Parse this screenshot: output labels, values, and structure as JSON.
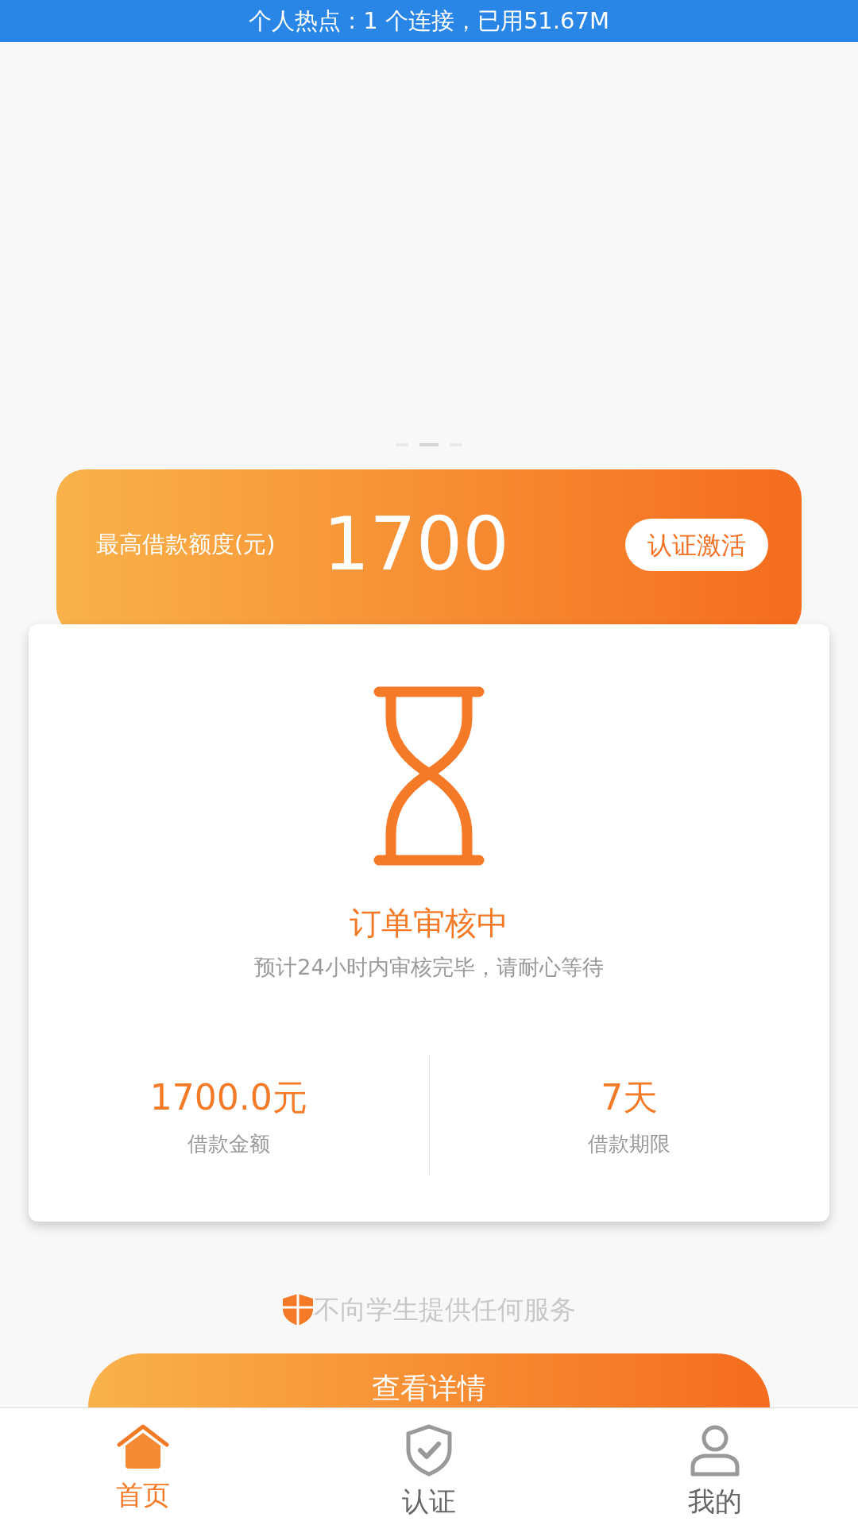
{
  "status_bar": {
    "text": "个人热点 : 1 个连接，已用51.67M"
  },
  "carousel": {
    "dots": [
      {
        "selected": false
      },
      {
        "selected": true
      },
      {
        "selected": false
      }
    ]
  },
  "limit_card": {
    "label": "最高借款额度(元)",
    "amount": "1700",
    "button": "认证激活"
  },
  "order_card": {
    "title": "订单审核中",
    "subtitle": "预计24小时内审核完毕，请耐心等待",
    "stats": [
      {
        "value": "1700.0元",
        "label": "借款金额"
      },
      {
        "value": "7天",
        "label": "借款期限"
      }
    ]
  },
  "notice": "不向学生提供任何服务",
  "details_button": "查看详情",
  "tab_bar": [
    {
      "label": "首页",
      "kind": "home",
      "selected": true
    },
    {
      "label": "认证",
      "kind": "verify",
      "selected": false
    },
    {
      "label": "我的",
      "kind": "profile",
      "selected": false
    }
  ]
}
